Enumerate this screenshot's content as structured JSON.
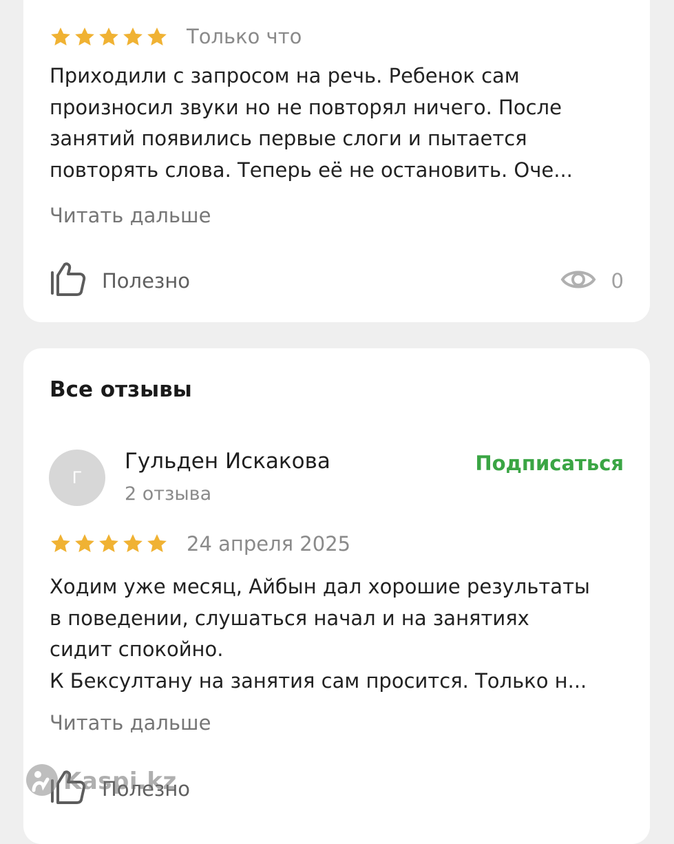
{
  "reviews_top": {
    "rating": 5,
    "date": "Только что",
    "text": "Приходили с запросом на речь. Ребенок сам\nпроизносил звуки но не повторял ничего. После\nзанятий появились первые слоги и пытается\nповторять слова. Теперь её не остановить. Оче...",
    "read_more": "Читать дальше",
    "useful_label": "Полезно",
    "views_count": "0",
    "icons": {
      "like": "thumbs-up-icon",
      "views": "eye-icon",
      "star": "star-icon"
    }
  },
  "all_reviews": {
    "title": "Все отзывы",
    "review": {
      "author": {
        "initial": "Г",
        "name": "Гульден Искакова",
        "reviews_count": "2 отзыва"
      },
      "subscribe_label": "Подписаться",
      "rating": 5,
      "date": "24 апреля 2025",
      "text": "Ходим уже месяц, Айбын дал хорошие результаты\nв поведении, слушаться начал и на занятиях\nсидит спокойно.\nК Бексултану на занятия сам просится. Только н...",
      "read_more": "Читать дальше",
      "useful_label": "Полезно"
    }
  },
  "watermark": {
    "text": "Kaspi.kz",
    "icon": "kaspi-logo-icon"
  },
  "colors": {
    "star": "#F0B233",
    "subscribe": "#3AA544",
    "background": "#EFEFEF",
    "card": "#FFFFFF"
  }
}
